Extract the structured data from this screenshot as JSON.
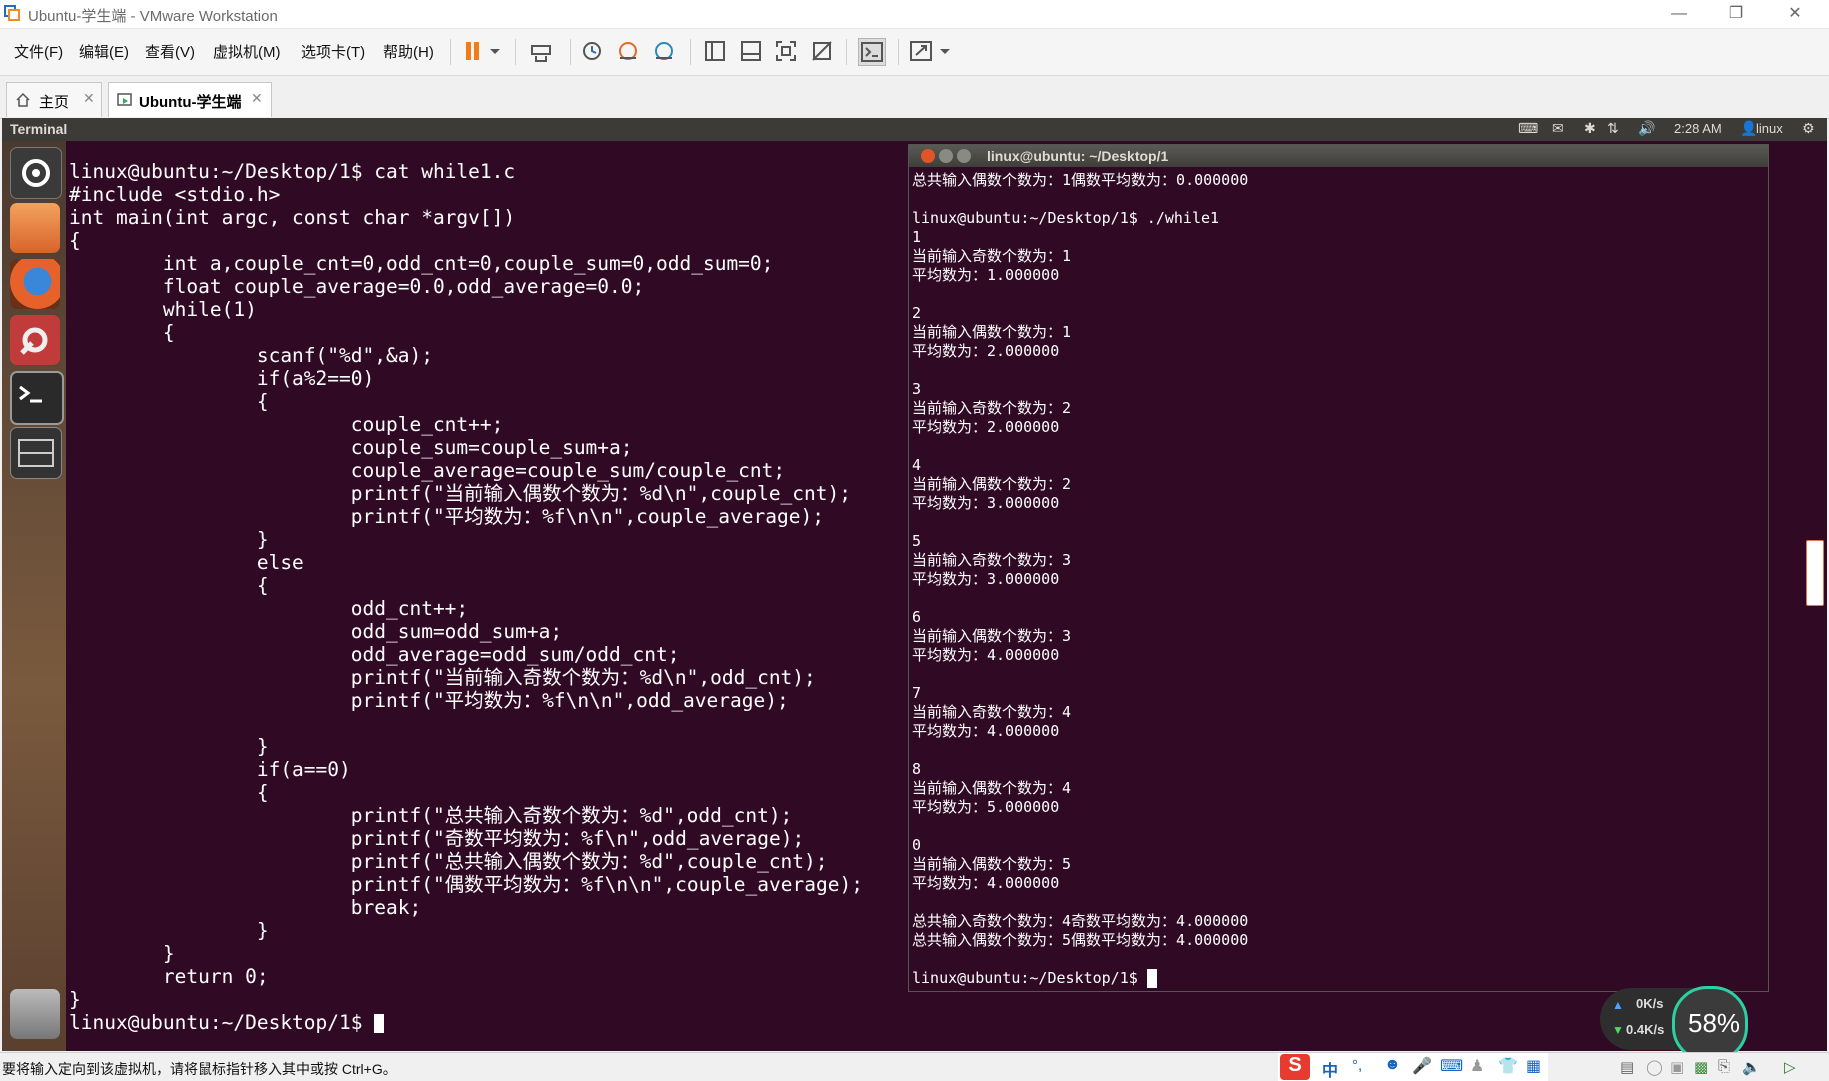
{
  "window": {
    "title": "Ubuntu-学生端 - VMware Workstation"
  },
  "menu": [
    "文件(F)",
    "编辑(E)",
    "查看(V)",
    "虚拟机(M)",
    "选项卡(T)",
    "帮助(H)"
  ],
  "tabs": [
    {
      "label": "主页",
      "active": false
    },
    {
      "label": "Ubuntu-学生端",
      "active": true
    }
  ],
  "ubuntu_panel": {
    "title": "Terminal",
    "time": "2:28 AM",
    "user": "linux"
  },
  "background_terminal": {
    "lines": [
      "linux@ubuntu:~/Desktop/1$ cat while1.c",
      "#include <stdio.h>",
      "int main(int argc, const char *argv[])",
      "{",
      "        int a,couple_cnt=0,odd_cnt=0,couple_sum=0,odd_sum=0;",
      "        float couple_average=0.0,odd_average=0.0;",
      "        while(1)",
      "        {",
      "                scanf(\"%d\",&a);",
      "                if(a%2==0)",
      "                {",
      "                        couple_cnt++;",
      "                        couple_sum=couple_sum+a;",
      "                        couple_average=couple_sum/couple_cnt;",
      "                        printf(\"当前输入偶数个数为：%d\\n\",couple_cnt);",
      "                        printf(\"平均数为：%f\\n\\n\",couple_average);",
      "                }",
      "                else",
      "                {",
      "                        odd_cnt++;",
      "                        odd_sum=odd_sum+a;",
      "                        odd_average=odd_sum/odd_cnt;",
      "                        printf(\"当前输入奇数个数为：%d\\n\",odd_cnt);",
      "                        printf(\"平均数为：%f\\n\\n\",odd_average);",
      "",
      "                }",
      "                if(a==0)",
      "                {",
      "                        printf(\"总共输入奇数个数为：%d\",odd_cnt);",
      "                        printf(\"奇数平均数为：%f\\n\",odd_average);",
      "                        printf(\"总共输入偶数个数为：%d\",couple_cnt);",
      "                        printf(\"偶数平均数为：%f\\n\\n\",couple_average);",
      "                        break;",
      "                }",
      "        }",
      "        return 0;",
      "}",
      "linux@ubuntu:~/Desktop/1$ "
    ]
  },
  "front_terminal": {
    "title": "linux@ubuntu: ~/Desktop/1",
    "lines": [
      "总共输入偶数个数为：1偶数平均数为：0.000000",
      "",
      "linux@ubuntu:~/Desktop/1$ ./while1",
      "1",
      "当前输入奇数个数为：1",
      "平均数为：1.000000",
      "",
      "2",
      "当前输入偶数个数为：1",
      "平均数为：2.000000",
      "",
      "3",
      "当前输入奇数个数为：2",
      "平均数为：2.000000",
      "",
      "4",
      "当前输入偶数个数为：2",
      "平均数为：3.000000",
      "",
      "5",
      "当前输入奇数个数为：3",
      "平均数为：3.000000",
      "",
      "6",
      "当前输入偶数个数为：3",
      "平均数为：4.000000",
      "",
      "7",
      "当前输入奇数个数为：4",
      "平均数为：4.000000",
      "",
      "8",
      "当前输入偶数个数为：4",
      "平均数为：5.000000",
      "",
      "0",
      "当前输入偶数个数为：5",
      "平均数为：4.000000",
      "",
      "总共输入奇数个数为：4奇数平均数为：4.000000",
      "总共输入偶数个数为：5偶数平均数为：4.000000",
      "",
      "linux@ubuntu:~/Desktop/1$ "
    ]
  },
  "net_widget": {
    "up": "0K/s",
    "down": "0.4K/s",
    "percent": "58%"
  },
  "status": {
    "text": "要将输入定向到该虚拟机，请将鼠标指针移入其中或按 Ctrl+G。"
  },
  "ime": {
    "mode": "中"
  },
  "colors": {
    "terminal_bg": "#300a24",
    "panel_bg": "#3c3b37",
    "gauge_ring": "#2bd1a4"
  }
}
